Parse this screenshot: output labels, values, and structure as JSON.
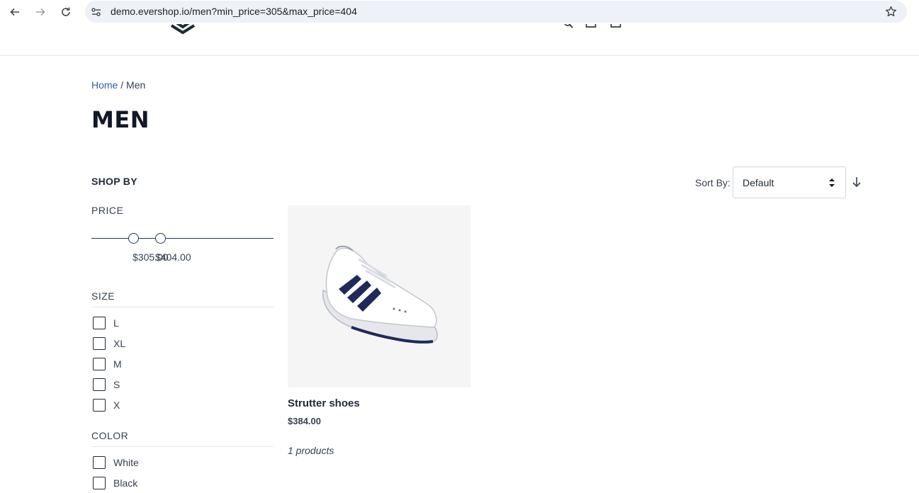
{
  "browser": {
    "url": "demo.evershop.io/men?min_price=305&max_price=404"
  },
  "breadcrumb": {
    "home": "Home",
    "separator": "/",
    "current": "Men"
  },
  "page": {
    "title": "MEN"
  },
  "sidebar": {
    "heading": "SHOP BY",
    "price": {
      "title": "PRICE",
      "min_label": "$305.00",
      "max_label": "$404.00"
    },
    "size": {
      "title": "SIZE",
      "options": [
        "L",
        "XL",
        "M",
        "S",
        "X"
      ]
    },
    "color": {
      "title": "COLOR",
      "options": [
        "White",
        "Black"
      ]
    }
  },
  "sort": {
    "label": "Sort By:",
    "selected": "Default"
  },
  "products": [
    {
      "name": "Strutter shoes",
      "price": "$384.00",
      "image": "white-sneaker-navy-stripes"
    }
  ],
  "product_count": "1 products",
  "colors": {
    "link": "#2f62ad",
    "slider": "#1e3a5f",
    "image_bg": "#f5f5f5"
  }
}
